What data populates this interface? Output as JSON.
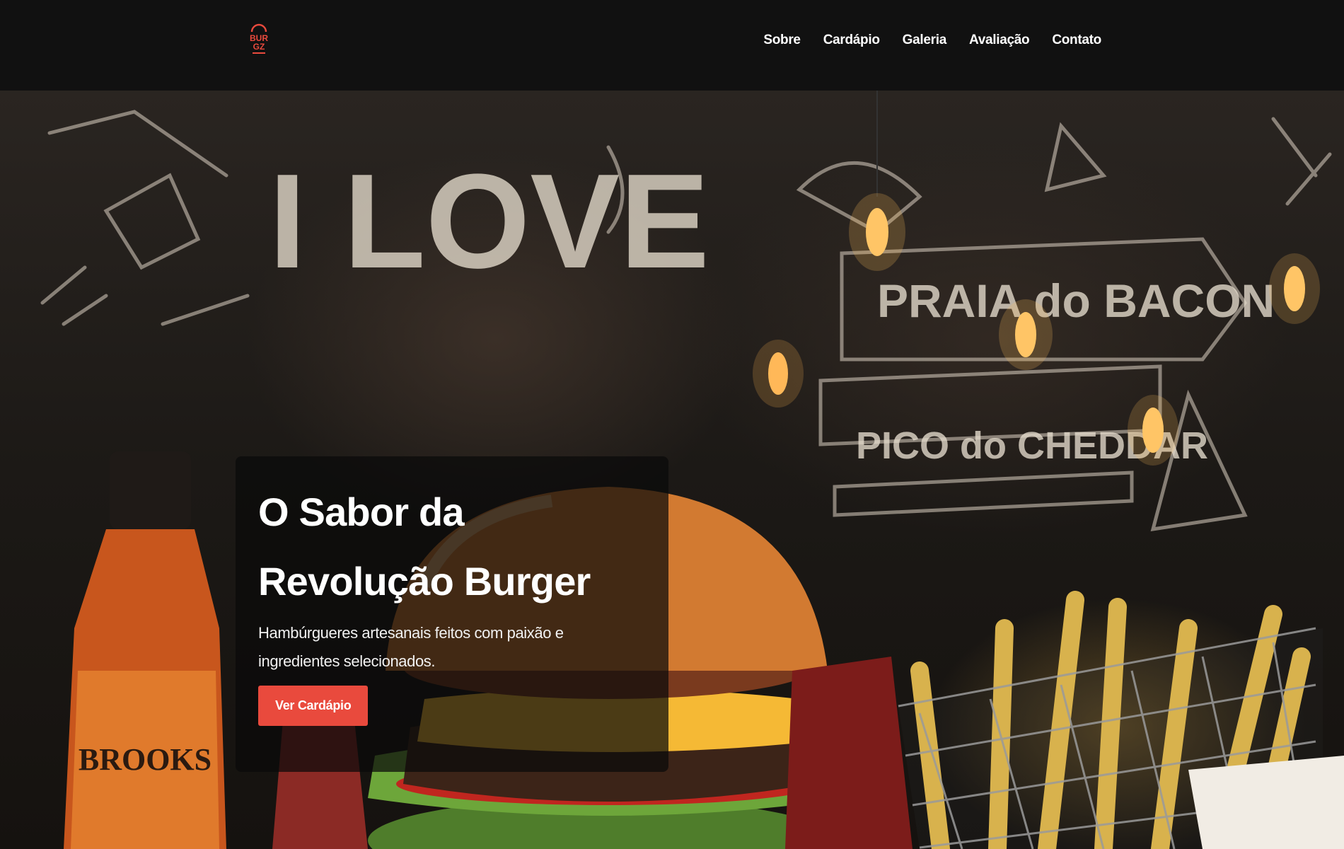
{
  "brand": {
    "logo_text_top": "BUR",
    "logo_text_bottom": "GZ"
  },
  "nav": {
    "items": [
      "Sobre",
      "Cardápio",
      "Galeria",
      "Avaliação",
      "Contato"
    ]
  },
  "hero": {
    "title": "O Sabor da Revolução Burger",
    "subtitle": "Hambúrgueres artesanais feitos com paixão e ingredientes selecionados.",
    "cta_label": "Ver Cardápio",
    "background_signage": [
      "I LOVE",
      "PRAIA do BACON",
      "PICO do CHEDDAR",
      "BROOKS"
    ]
  },
  "colors": {
    "header_bg": "#111111",
    "accent": "#e94a3d",
    "text": "#ffffff"
  }
}
